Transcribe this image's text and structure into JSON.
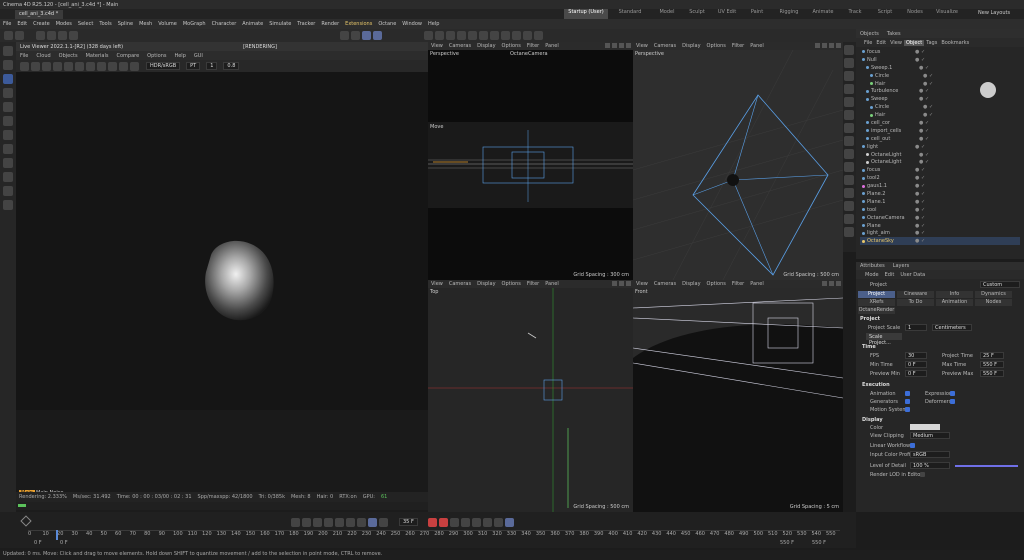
{
  "app": {
    "title": "Cinema 4D R25.120 - [cell_ani_3.c4d *] - Main",
    "file_tab": "cell_ani_3.c4d *"
  },
  "menu": [
    "File",
    "Edit",
    "Create",
    "Modes",
    "Select",
    "Tools",
    "Spline",
    "Mesh",
    "Volume",
    "MoGraph",
    "Character",
    "Animate",
    "Simulate",
    "Tracker",
    "Render",
    "Extensions",
    "Octane",
    "Window",
    "Help"
  ],
  "layouts": [
    "Startup (User)",
    "Standard",
    "Model",
    "Sculpt",
    "UV Edit",
    "Paint",
    "Rigging",
    "Animate",
    "Track",
    "Script",
    "Nodes",
    "Visualize"
  ],
  "new_layouts": "New Layouts",
  "live_viewer": {
    "tab": "Live Viewer 2022.1.1-[R2] (328 days left)",
    "tab_badge": "[RENDERING]",
    "menu": [
      "File",
      "Cloud",
      "Objects",
      "Materials",
      "Compare",
      "Options",
      "Help",
      "GUI"
    ],
    "color_space": "HDR/sRGB",
    "pt_mode": "PT",
    "frame_value": "1",
    "zoom": "0.8",
    "render_overlay": "Main",
    "render_label": "Main Noise",
    "status": {
      "rendering": "Rendering: 2.333%",
      "mssec": "Ms/sec: 31.492",
      "time": "Time: 00 : 00 : 03/00 : 02 : 31",
      "spp": "Spp/maxspp: 42/1800",
      "tri": "Tri: 0/385k",
      "mesh": "Mesh: 8",
      "hair": "Hair: 0",
      "rtx": "RTX:on",
      "gpu": "GPU:",
      "gpu_value": "61"
    }
  },
  "viewports": [
    {
      "menu": [
        "View",
        "Cameras",
        "Display",
        "Options",
        "Filter",
        "Panel"
      ],
      "label": "Perspective",
      "camera": "OctaneCamera",
      "grid": ""
    },
    {
      "menu": [
        "View",
        "Cameras",
        "Display",
        "Options",
        "Filter",
        "Panel"
      ],
      "label": "Perspective",
      "camera": "",
      "grid": "Grid Spacing : 500 cm"
    },
    {
      "menu": [
        "View",
        "Cameras",
        "Display",
        "Options",
        "Filter",
        "Panel"
      ],
      "label": "Top",
      "camera": "",
      "grid": "Grid Spacing : 500 cm"
    },
    {
      "menu": [
        "View",
        "Cameras",
        "Display",
        "Options",
        "Filter",
        "Panel"
      ],
      "label": "Front",
      "camera": "",
      "grid": "Grid Spacing : 5 cm"
    }
  ],
  "move_label": "Move",
  "top_grid": "Grid Spacing : 300 cm",
  "objects": {
    "tabs": [
      "Objects",
      "Takes"
    ],
    "menu": [
      "File",
      "Edit",
      "View",
      "Object",
      "Tags",
      "Bookmarks"
    ],
    "items": [
      {
        "name": "focus"
      },
      {
        "name": "Null"
      },
      {
        "name": "Sweep.1"
      },
      {
        "name": "Circle"
      },
      {
        "name": "Hair"
      },
      {
        "name": "Turbulence"
      },
      {
        "name": "Sweep"
      },
      {
        "name": "Circle"
      },
      {
        "name": "Hair"
      },
      {
        "name": "cell_cor"
      },
      {
        "name": "import_cells"
      },
      {
        "name": "cell_out"
      },
      {
        "name": "light"
      },
      {
        "name": "OctaneLight"
      },
      {
        "name": "OctaneLight"
      },
      {
        "name": "focus"
      },
      {
        "name": "tool2"
      },
      {
        "name": "gaus1.1"
      },
      {
        "name": "Plane.2"
      },
      {
        "name": "Plane.1"
      },
      {
        "name": "tool"
      },
      {
        "name": "OctaneCamera"
      },
      {
        "name": "Plane"
      },
      {
        "name": "light_aim"
      },
      {
        "name": "OctaneSky"
      }
    ]
  },
  "attributes": {
    "tabs": [
      "Attributes",
      "Layers"
    ],
    "menu": [
      "Mode",
      "Edit",
      "User Data"
    ],
    "object": "Project",
    "preset": "Custom",
    "tabrow1": [
      "Project",
      "Cineware",
      "Info",
      "Dynamics"
    ],
    "tabrow2": [
      "XRefs",
      "To Do",
      "Animation",
      "Nodes"
    ],
    "tabrow3": "OctaneRender",
    "project": {
      "header": "Project",
      "scale_label": "Project Scale",
      "scale_value": "1",
      "scale_unit": "Centimeters",
      "scale_btn": "Scale Project..."
    },
    "time": {
      "header": "Time",
      "fps_label": "FPS",
      "fps": "30",
      "ptime_label": "Project Time",
      "ptime": "25 F",
      "min_label": "Min Time",
      "min": "0 F",
      "max_label": "Max Time",
      "max": "550 F",
      "pmin_label": "Preview Min",
      "pmin": "0 F",
      "pmax_label": "Preview Max",
      "pmax": "550 F"
    },
    "execution": {
      "header": "Execution",
      "anim": "Animation",
      "expr": "Expressions",
      "gen": "Generators",
      "def": "Deformers",
      "msys": "Motion System"
    },
    "display": {
      "header": "Display",
      "color": "Color",
      "clipping": "View Clipping",
      "clipping_value": "Medium",
      "linear": "Linear Workflow",
      "profile": "Input Color Profile",
      "profile_value": "sRGB",
      "lod": "Level of Detail",
      "lod_value": "100 %",
      "render_lod": "Render LOD in Editor"
    }
  },
  "timeline": {
    "frame": "35 F",
    "ticks": [
      "0",
      "10",
      "20",
      "30",
      "40",
      "50",
      "60",
      "70",
      "80",
      "90",
      "100",
      "110",
      "120",
      "130",
      "140",
      "150",
      "160",
      "170",
      "180",
      "190",
      "200",
      "210",
      "220",
      "230",
      "240",
      "250",
      "260",
      "270",
      "280",
      "290",
      "300",
      "310",
      "320",
      "330",
      "340",
      "350",
      "360",
      "370",
      "380",
      "390",
      "400",
      "410",
      "420",
      "430",
      "440",
      "450",
      "460",
      "470",
      "480",
      "490",
      "500",
      "510",
      "520",
      "530",
      "540",
      "550"
    ],
    "start": "0 F",
    "start2": "0 F",
    "end": "550 F",
    "end2": "550 F"
  },
  "status": "Updated: 0 ms.    Move: Click and drag to move elements. Hold down SHIFT to quantize movement / add to the selection in point mode, CTRL to remove."
}
